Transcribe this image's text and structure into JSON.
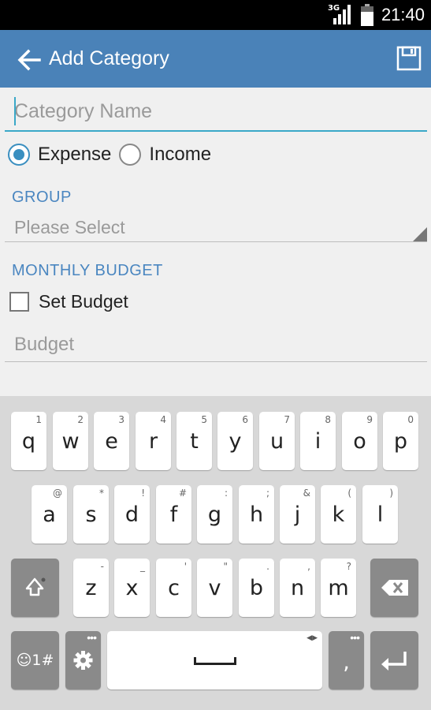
{
  "status_bar": {
    "network": "3G",
    "time": "21:40"
  },
  "app_bar": {
    "title": "Add Category",
    "back_icon": "arrow-left-icon",
    "save_icon": "floppy-disk-icon"
  },
  "form": {
    "name_placeholder": "Category Name",
    "name_value": "",
    "type_options": [
      {
        "label": "Expense",
        "checked": true
      },
      {
        "label": "Income",
        "checked": false
      }
    ],
    "group_label": "GROUP",
    "group_value": "Please Select",
    "budget_section_label": "MONTHLY BUDGET",
    "set_budget_label": "Set Budget",
    "set_budget_checked": false,
    "budget_placeholder": "Budget"
  },
  "keyboard": {
    "row1": [
      {
        "key": "q",
        "hint": "1"
      },
      {
        "key": "w",
        "hint": "2"
      },
      {
        "key": "e",
        "hint": "3"
      },
      {
        "key": "r",
        "hint": "4"
      },
      {
        "key": "t",
        "hint": "5"
      },
      {
        "key": "y",
        "hint": "6"
      },
      {
        "key": "u",
        "hint": "7"
      },
      {
        "key": "i",
        "hint": "8"
      },
      {
        "key": "o",
        "hint": "9"
      },
      {
        "key": "p",
        "hint": "0"
      }
    ],
    "row2": [
      {
        "key": "a",
        "hint": "@"
      },
      {
        "key": "s",
        "hint": "*"
      },
      {
        "key": "d",
        "hint": "!"
      },
      {
        "key": "f",
        "hint": "#"
      },
      {
        "key": "g",
        "hint": ":"
      },
      {
        "key": "h",
        "hint": ";"
      },
      {
        "key": "j",
        "hint": "&"
      },
      {
        "key": "k",
        "hint": "("
      },
      {
        "key": "l",
        "hint": ")"
      }
    ],
    "row3": [
      {
        "key": "z",
        "hint": "-"
      },
      {
        "key": "x",
        "hint": "_"
      },
      {
        "key": "c",
        "hint": "'"
      },
      {
        "key": "v",
        "hint": "\""
      },
      {
        "key": "b",
        "hint": "."
      },
      {
        "key": "n",
        "hint": ","
      },
      {
        "key": "m",
        "hint": "?"
      }
    ],
    "emoji_key": "☺1#",
    "comma_key": ",",
    "accent_color": "#4a82b8"
  }
}
